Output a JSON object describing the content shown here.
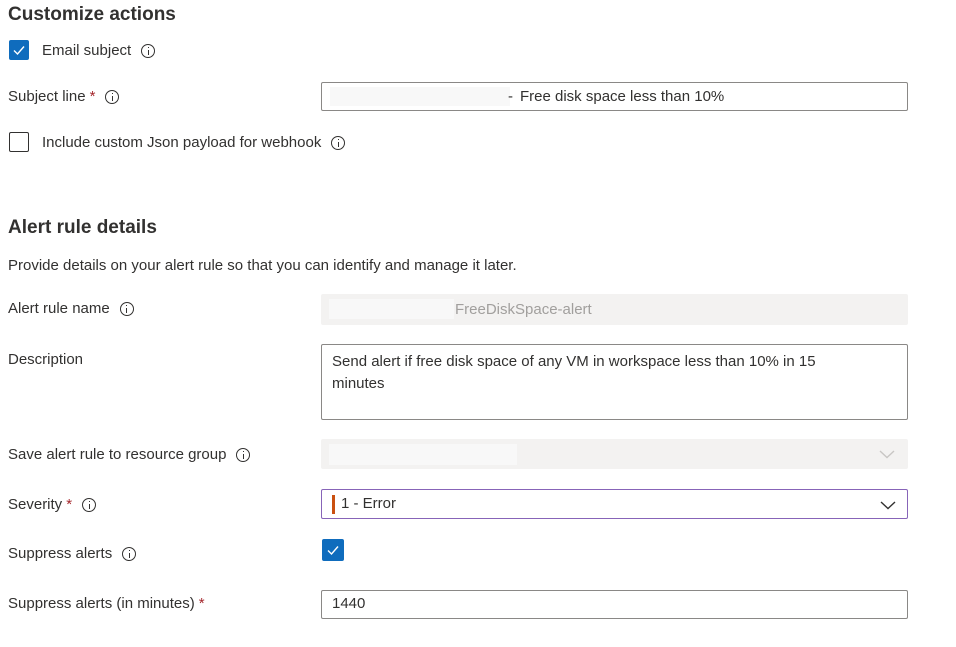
{
  "customize": {
    "heading": "Customize actions",
    "email_subject_label": "Email subject",
    "subject_line_label": "Subject line",
    "subject_line_value": "Free disk space less than 10%",
    "json_payload_label": "Include custom Json payload for webhook"
  },
  "details": {
    "heading": "Alert rule details",
    "intro": "Provide details on your alert rule so that you can identify and manage it later.",
    "rule_name_label": "Alert rule name",
    "rule_name_value": "FreeDiskSpace-alert",
    "description_label": "Description",
    "description_value": "Send alert if free disk space  of any VM in workspace less than 10% in 15 minutes",
    "resource_group_label": "Save alert rule to resource group",
    "severity_label": "Severity",
    "severity_value": "1 - Error",
    "suppress_label": "Suppress alerts",
    "suppress_minutes_label": "Suppress alerts (in minutes)",
    "suppress_minutes_value": "1440"
  },
  "icons": {
    "info": "info-icon",
    "check": "checkmark-icon",
    "chevron": "chevron-down-icon"
  },
  "colors": {
    "accent": "#0f6cbd",
    "required": "#a4262c",
    "severity_error": "#ca5010",
    "focus_border": "#8764b8"
  }
}
